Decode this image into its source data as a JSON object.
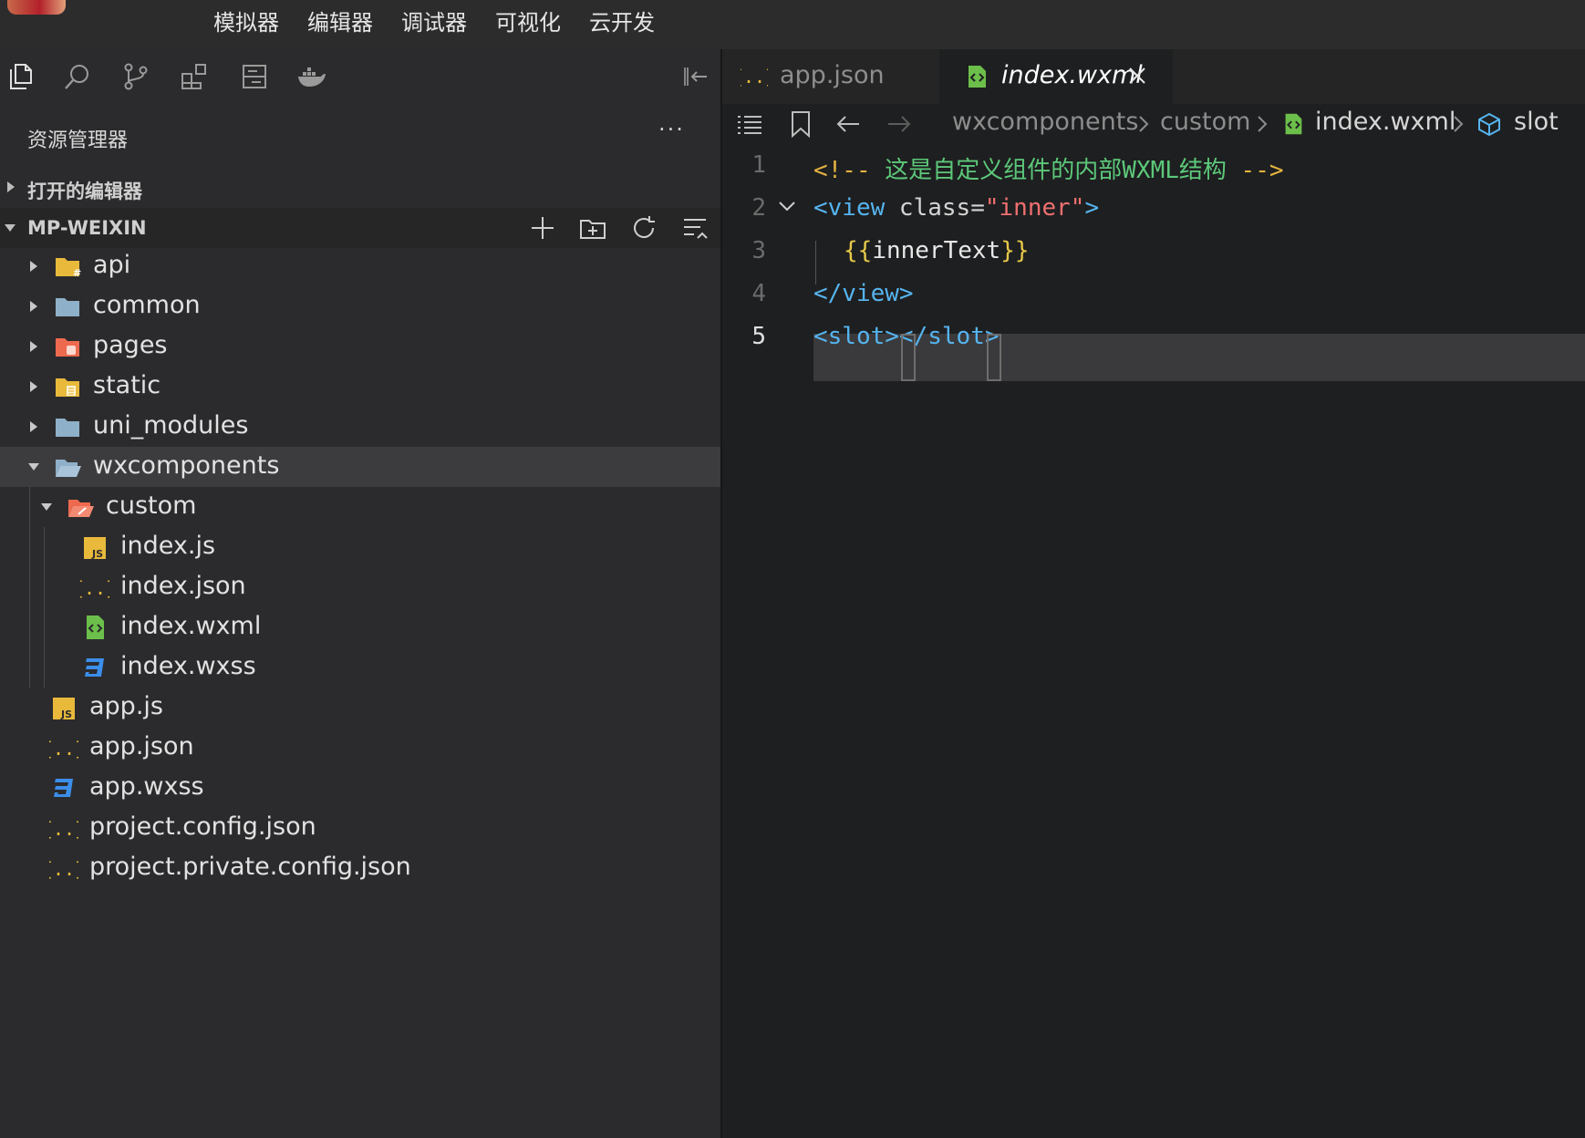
{
  "topmenu": [
    "模拟器",
    "编辑器",
    "调试器",
    "可视化",
    "云开发"
  ],
  "toolbar_icons": [
    "files-icon",
    "search-icon",
    "source-control-icon",
    "extensions-icon",
    "storage-icon",
    "docker-icon"
  ],
  "explorer": {
    "title": "资源管理器",
    "more": "···",
    "open_editors": "打开的编辑器",
    "project": "MP-WEIXIN"
  },
  "tree": [
    {
      "name": "api",
      "icon": "folder-api-icon",
      "depth": 0,
      "twisty": "closed"
    },
    {
      "name": "common",
      "icon": "folder-icon",
      "depth": 0,
      "twisty": "closed"
    },
    {
      "name": "pages",
      "icon": "folder-pages-icon",
      "depth": 0,
      "twisty": "closed"
    },
    {
      "name": "static",
      "icon": "folder-static-icon",
      "depth": 0,
      "twisty": "closed"
    },
    {
      "name": "uni_modules",
      "icon": "folder-icon",
      "depth": 0,
      "twisty": "closed"
    },
    {
      "name": "wxcomponents",
      "icon": "folder-open-icon",
      "depth": 0,
      "twisty": "open",
      "selected": true
    },
    {
      "name": "custom",
      "icon": "folder-open-red-icon",
      "depth": 1,
      "twisty": "open"
    },
    {
      "name": "index.js",
      "icon": "js-file-icon",
      "depth": 2
    },
    {
      "name": "index.json",
      "icon": "json-file-icon",
      "depth": 2
    },
    {
      "name": "index.wxml",
      "icon": "wxml-file-icon",
      "depth": 2
    },
    {
      "name": "index.wxss",
      "icon": "css-file-icon",
      "depth": 2
    },
    {
      "name": "app.js",
      "icon": "js-file-icon",
      "depth": 0.5
    },
    {
      "name": "app.json",
      "icon": "json-file-icon",
      "depth": 0.5
    },
    {
      "name": "app.wxss",
      "icon": "css-file-icon",
      "depth": 0.5
    },
    {
      "name": "project.config.json",
      "icon": "json-file-icon",
      "depth": 0.5
    },
    {
      "name": "project.private.config.json",
      "icon": "json-file-icon",
      "depth": 0.5
    }
  ],
  "tabs": [
    {
      "label": "app.json",
      "icon": "json-file-icon",
      "active": false
    },
    {
      "label": "index.wxml",
      "icon": "wxml-file-icon",
      "active": true
    }
  ],
  "breadcrumb": [
    "wxcomponents",
    "custom",
    "index.wxml",
    "slot"
  ],
  "line_numbers": [
    "1",
    "2",
    "3",
    "4",
    "5"
  ],
  "code": {
    "l1_open": "<!--",
    "l1_text": " 这是自定义组件的内部WXML结构 ",
    "l1_close": "-->",
    "l2_tag": "<view",
    "l2_attr": " class=",
    "l2_q1": "\"",
    "l2_val": "inner",
    "l2_q2": "\"",
    "l2_end": ">",
    "l3_open": "{{",
    "l3_var": "innerText",
    "l3_close": "}}",
    "l4": "</view>",
    "l5_a": "<slot>",
    "l5_b": "</slot>"
  },
  "colors": {
    "comment": "#5cc87a",
    "comment_delim": "#e3b341",
    "tag": "#56b4ef",
    "attr": "#d4d4d4",
    "string": "#ef6f6f",
    "mustache_brace": "#e6c84a",
    "mustache_inner": "#cc7ddc",
    "var": "#e8e8e8"
  }
}
